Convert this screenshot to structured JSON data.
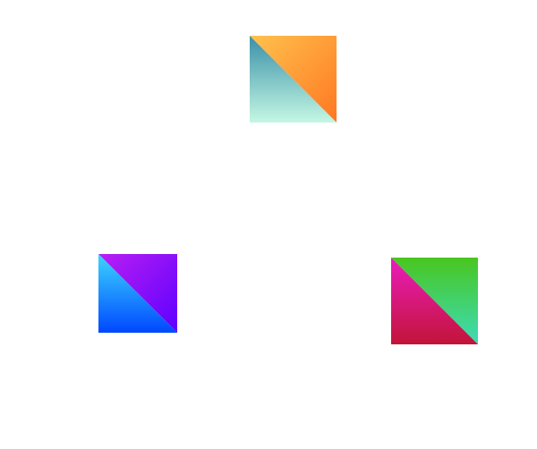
{
  "tiles": [
    {
      "id": "tile-1",
      "upper_right": {
        "from": "#ffc24d",
        "to": "#ff7722"
      },
      "lower_left": {
        "from": "#3a90a8",
        "to": "#c4f7e4"
      }
    },
    {
      "id": "tile-2",
      "upper_right": {
        "from": "#b91ff2",
        "to": "#5c00ff"
      },
      "lower_left": {
        "from": "#3cd6ff",
        "to": "#0048ff"
      }
    },
    {
      "id": "tile-3",
      "upper_right": {
        "from": "#49c61f",
        "to": "#3cdcb8"
      },
      "lower_left": {
        "from": "#ea1dbd",
        "to": "#c21438"
      }
    }
  ]
}
